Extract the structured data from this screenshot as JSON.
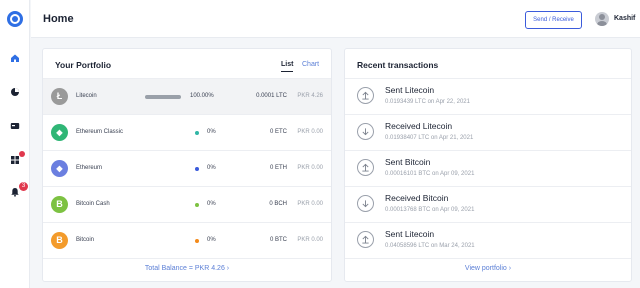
{
  "header": {
    "title": "Home",
    "send_receive": "Send / Receive",
    "user_name": "Kashif"
  },
  "sidebar": {
    "items": [
      {
        "icon": "home-icon",
        "active": true
      },
      {
        "icon": "pie-chart-icon"
      },
      {
        "icon": "card-icon"
      },
      {
        "icon": "apps-icon",
        "badge_dot": true
      },
      {
        "icon": "bell-icon",
        "badge_count": "3"
      }
    ]
  },
  "portfolio": {
    "title": "Your Portfolio",
    "tabs": [
      "List",
      "Chart"
    ],
    "active_tab": "List",
    "rows": [
      {
        "name": "Litecoin",
        "icon": "litecoin-icon",
        "color": "#9a9a9a",
        "glyph": "Ł",
        "percent": "100.00%",
        "share": 1.0,
        "amount": "0.0001 LTC",
        "fiat": "PKR 4.26"
      },
      {
        "name": "Ethereum Classic",
        "icon": "ethereum-classic-icon",
        "color": "#30b676",
        "glyph": "◆",
        "percent": "0%",
        "share": 0,
        "dot_color": "#30b6a6",
        "amount": "0 ETC",
        "fiat": "PKR 0.00"
      },
      {
        "name": "Ethereum",
        "icon": "ethereum-icon",
        "color": "#6b7fe0",
        "glyph": "◆",
        "percent": "0%",
        "share": 0,
        "dot_color": "#3b5bdb",
        "amount": "0 ETH",
        "fiat": "PKR 0.00"
      },
      {
        "name": "Bitcoin Cash",
        "icon": "bitcoin-cash-icon",
        "color": "#7dc242",
        "glyph": "B",
        "percent": "0%",
        "share": 0,
        "dot_color": "#7dc242",
        "amount": "0 BCH",
        "fiat": "PKR 0.00"
      },
      {
        "name": "Bitcoin",
        "icon": "bitcoin-icon",
        "color": "#f39b2b",
        "glyph": "B",
        "percent": "0%",
        "share": 0,
        "dot_color": "#f38a1a",
        "amount": "0 BTC",
        "fiat": "PKR 0.00"
      }
    ],
    "total": "Total Balance = PKR 4.26 ›"
  },
  "recent": {
    "title": "Recent transactions",
    "items": [
      {
        "type": "sent",
        "icon": "arrow-up-icon",
        "title": "Sent Litecoin",
        "detail": "0.0193439 LTC on Apr 22, 2021"
      },
      {
        "type": "received",
        "icon": "arrow-down-icon",
        "title": "Received Litecoin",
        "detail": "0.01938407 LTC on Apr 21, 2021"
      },
      {
        "type": "sent",
        "icon": "arrow-up-icon",
        "title": "Sent Bitcoin",
        "detail": "0.00016101 BTC on Apr 09, 2021"
      },
      {
        "type": "received",
        "icon": "arrow-down-icon",
        "title": "Received Bitcoin",
        "detail": "0.00013768 BTC on Apr 09, 2021"
      },
      {
        "type": "sent",
        "icon": "arrow-up-icon",
        "title": "Sent Litecoin",
        "detail": "0.04058596 LTC on Mar 24, 2021"
      }
    ],
    "footer": "View portfolio ›"
  },
  "colors": {
    "accent": "#3b5bdb",
    "link": "#5b7fd6",
    "badge": "#e0384d"
  }
}
